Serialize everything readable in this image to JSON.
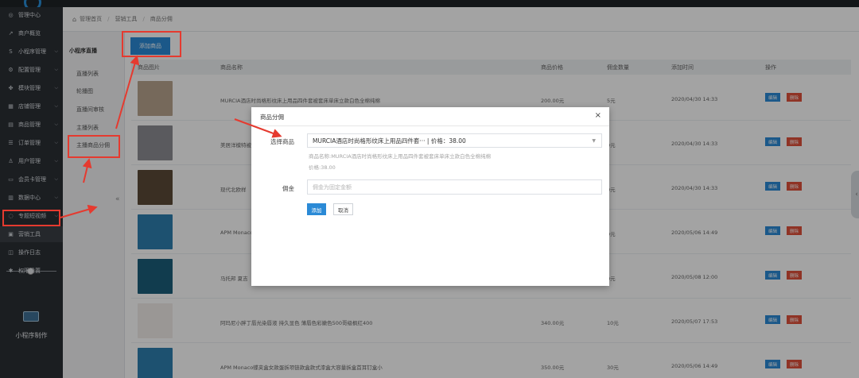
{
  "sidebar": {
    "items": [
      {
        "label": "管理中心",
        "icon": "dashboard-icon",
        "glyph": "◎",
        "chevron": false
      },
      {
        "label": "商户概览",
        "icon": "chart-line-icon",
        "glyph": "↗",
        "chevron": false
      },
      {
        "label": "小程序管理",
        "icon": "s-logo-icon",
        "glyph": "S",
        "chevron": true
      },
      {
        "label": "配置管理",
        "icon": "gear-icon",
        "glyph": "⚙",
        "chevron": true
      },
      {
        "label": "模块管理",
        "icon": "modules-icon",
        "glyph": "✤",
        "chevron": true
      },
      {
        "label": "店铺管理",
        "icon": "shop-icon",
        "glyph": "▦",
        "chevron": true
      },
      {
        "label": "商品管理",
        "icon": "goods-icon",
        "glyph": "▤",
        "chevron": true
      },
      {
        "label": "订单管理",
        "icon": "order-icon",
        "glyph": "☰",
        "chevron": true
      },
      {
        "label": "用户管理",
        "icon": "user-icon",
        "glyph": "♙",
        "chevron": true
      },
      {
        "label": "会员卡管理",
        "icon": "card-icon",
        "glyph": "▭",
        "chevron": true
      },
      {
        "label": "数据中心",
        "icon": "data-icon",
        "glyph": "▥",
        "chevron": true
      },
      {
        "label": "专题短视频",
        "icon": "video-icon",
        "glyph": "◌",
        "chevron": true
      },
      {
        "label": "营销工具",
        "icon": "briefcase-icon",
        "glyph": "▣",
        "chevron": false
      },
      {
        "label": "操作日志",
        "icon": "log-icon",
        "glyph": "◫",
        "chevron": false
      },
      {
        "label": "权限设置",
        "icon": "permission-icon",
        "glyph": "✱",
        "chevron": false
      }
    ],
    "bottom_label": "小程序制作"
  },
  "breadcrumb": [
    "管理首页",
    "营销工具",
    "商品分佣"
  ],
  "submenu": {
    "title": "小程序直播",
    "items": [
      "直播列表",
      "轮播图",
      "直播间审核",
      "主播列表",
      "主播商品分佣"
    ]
  },
  "toolbar": {
    "add_label": "添加商品"
  },
  "table": {
    "headers": [
      "商品图片",
      "商品名称",
      "商品价格",
      "佣金数量",
      "添加时间",
      "操作"
    ],
    "edit_label": "编辑",
    "delete_label": "删除",
    "rows": [
      {
        "name": "MURCIA酒店时尚格形纹床上用品四件套被套床单床立款白色全棉纯棉",
        "price": "200.00元",
        "commission": "5元",
        "time": "2020/04/30 14:33",
        "thumb": "#b9a58f"
      },
      {
        "name": "美居洋模特被套床上四件套-全",
        "price": "",
        "commission": "0元",
        "time": "2020/04/30 14:33",
        "thumb": "#8d8d93"
      },
      {
        "name": "现代北欧样",
        "price": "",
        "commission": "0元",
        "time": "2020/04/30 14:33",
        "thumb": "#5b4a37"
      },
      {
        "name": "APM Monaco",
        "price": "",
        "commission": "0元",
        "time": "2020/05/06 14:49",
        "thumb": "#2e7fb0"
      },
      {
        "name": "马托邦 夏吉",
        "price": "",
        "commission": "0元",
        "time": "2020/05/08 12:00",
        "thumb": "#1c5e7a"
      },
      {
        "name": "阿玛尼小胖丁唇光染唇液 持久显色 薄唇色彩嫩色500哥级枫红400",
        "price": "340.00元",
        "commission": "10元",
        "time": "2020/05/07 17:53",
        "thumb": "#f1ece9"
      },
      {
        "name": "APM Monaco蝶夹盒女款蛋拆项链款盒款式漆盒大容量拆盒首耳钉盒小",
        "price": "350.00元",
        "commission": "30元",
        "time": "2020/05/06 14:49",
        "thumb": "#2e7fb0"
      }
    ]
  },
  "modal": {
    "title": "商品分佣",
    "close": "×",
    "goods_label": "选择商品",
    "goods_value": "MURCIA酒店时尚格形纹床上用品四件套··· | 价格：38.00",
    "hint_name": "商品名称:MURCIA酒店时尚格形纹床上用品四件套被套床单床立款白色全棉纯棉",
    "hint_price": "价格:38.00",
    "commission_label": "佣金",
    "commission_placeholder": "佣金为固定金额",
    "submit_label": "添加",
    "cancel_label": "取消"
  },
  "colors": {
    "accent": "#2b8ad6",
    "danger": "#e0503a",
    "annotation": "#e53a2f",
    "sidebar_bg": "#2b2f35"
  }
}
